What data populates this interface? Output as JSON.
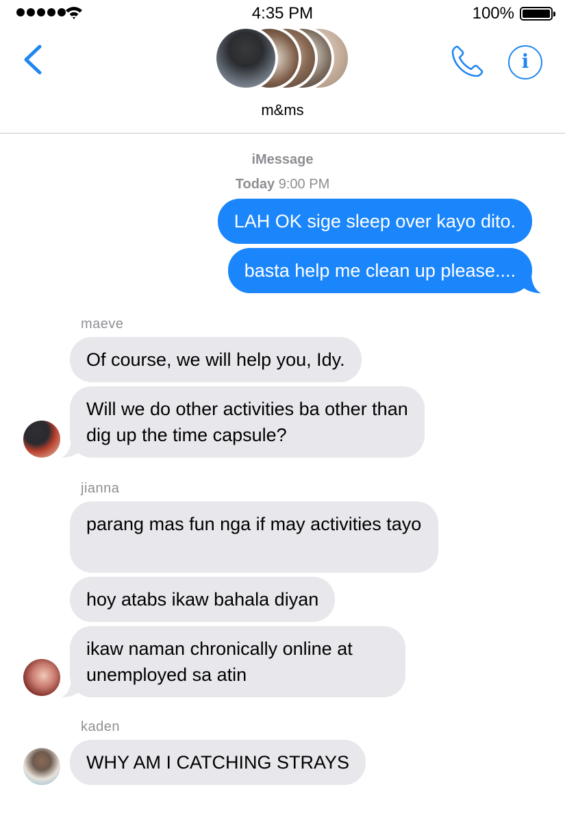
{
  "status_bar": {
    "time": "4:35 PM",
    "battery_percent": "100%",
    "battery_level": 1.0,
    "signal_bars": 5
  },
  "header": {
    "group_name": "m&ms",
    "back_icon": "chevron-left-icon",
    "call_icon": "phone-icon",
    "info_icon": "info-icon",
    "accent_color": "#1f86f0"
  },
  "thread": {
    "service_label": "iMessage",
    "timestamp_day": "Today",
    "timestamp_time": "9:00 PM"
  },
  "messages": {
    "m1": {
      "text": "LAH OK sige sleep over kayo dito."
    },
    "m2": {
      "text": "basta help me clean up please...."
    },
    "maeve": {
      "name": "maeve"
    },
    "m3": {
      "text": "Of course, we will help you, Idy."
    },
    "m4": {
      "text": "Will we do other activities ba other than dig up the time capsule?"
    },
    "jianna": {
      "name": "jianna"
    },
    "m5": {
      "text": "parang mas fun nga if may activities tayo"
    },
    "m6": {
      "text": "hoy atabs ikaw bahala diyan"
    },
    "m7": {
      "text": "ikaw naman chronically online at unemployed sa atin"
    },
    "kaden": {
      "name": "kaden"
    },
    "m8": {
      "text": "WHY AM I CATCHING STRAYS"
    }
  },
  "colors": {
    "outgoing_bubble": "#1b86fb",
    "incoming_bubble": "#e7e7ec",
    "meta_text": "#8e8e93"
  }
}
